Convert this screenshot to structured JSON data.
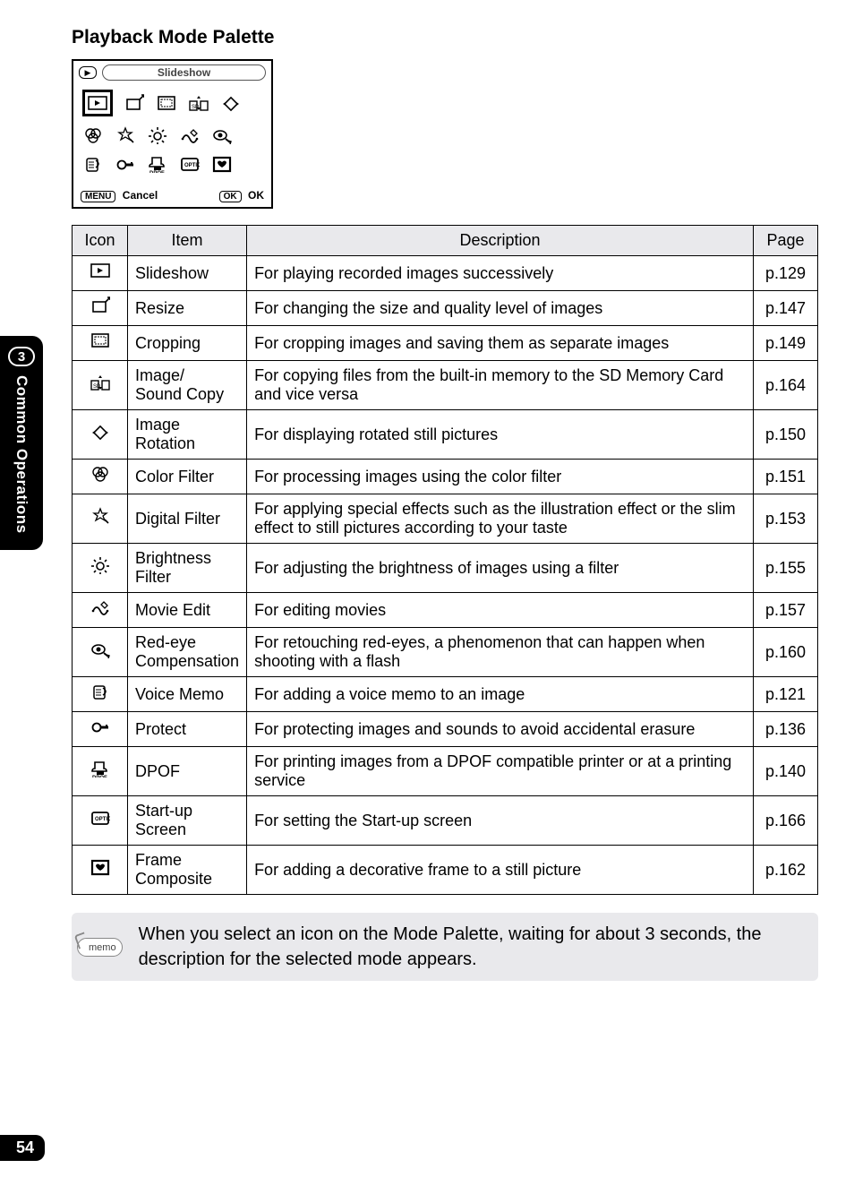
{
  "sidebar": {
    "chapter_number": "3",
    "chapter_title": "Common Operations"
  },
  "page_number": "54",
  "section_title": "Playback Mode Palette",
  "palette": {
    "header_label": "Slideshow",
    "footer_cancel_btn": "MENU",
    "footer_cancel_text": "Cancel",
    "footer_ok_btn": "OK",
    "footer_ok_text": "OK"
  },
  "table": {
    "headers": {
      "icon": "Icon",
      "item": "Item",
      "description": "Description",
      "page": "Page"
    },
    "rows": [
      {
        "icon": "slideshow",
        "item": "Slideshow",
        "description": "For playing recorded images successively",
        "page": "p.129"
      },
      {
        "icon": "resize",
        "item": "Resize",
        "description": "For changing the size and quality level of images",
        "page": "p.147"
      },
      {
        "icon": "cropping",
        "item": "Cropping",
        "description": "For cropping images and saving them as separate images",
        "page": "p.149"
      },
      {
        "icon": "copy",
        "item": "Image/\nSound Copy",
        "description": "For copying files from the built-in memory to the SD Memory Card and vice versa",
        "page": "p.164"
      },
      {
        "icon": "rotate",
        "item": "Image Rotation",
        "description": "For displaying rotated still pictures",
        "page": "p.150"
      },
      {
        "icon": "colorfilter",
        "item": "Color Filter",
        "description": "For processing images using the color filter",
        "page": "p.151"
      },
      {
        "icon": "digitalfilter",
        "item": "Digital Filter",
        "description": "For applying special effects such as the illustration effect or the slim effect to still pictures according to your taste",
        "page": "p.153"
      },
      {
        "icon": "brightness",
        "item": "Brightness Filter",
        "description": "For adjusting the brightness of images using a filter",
        "page": "p.155"
      },
      {
        "icon": "movieedit",
        "item": "Movie Edit",
        "description": "For editing movies",
        "page": "p.157"
      },
      {
        "icon": "redeye",
        "item": "Red-eye Compensation",
        "description": "For retouching red-eyes, a phenomenon that can happen when shooting with a flash",
        "page": "p.160"
      },
      {
        "icon": "voicememo",
        "item": "Voice Memo",
        "description": "For adding a voice memo to an image",
        "page": "p.121"
      },
      {
        "icon": "protect",
        "item": "Protect",
        "description": "For protecting images and sounds to avoid accidental erasure",
        "page": "p.136"
      },
      {
        "icon": "dpof",
        "item": "DPOF",
        "description": "For printing images from a DPOF compatible printer or at a printing service",
        "page": "p.140"
      },
      {
        "icon": "startup",
        "item": "Start-up Screen",
        "description": "For setting the Start-up screen",
        "page": "p.166"
      },
      {
        "icon": "frame",
        "item": "Frame Composite",
        "description": "For adding a decorative frame to a still picture",
        "page": "p.162"
      }
    ]
  },
  "memo": {
    "badge": "memo",
    "text": "When you select an icon on the Mode Palette, waiting for about 3 seconds, the description for the selected mode appears."
  }
}
